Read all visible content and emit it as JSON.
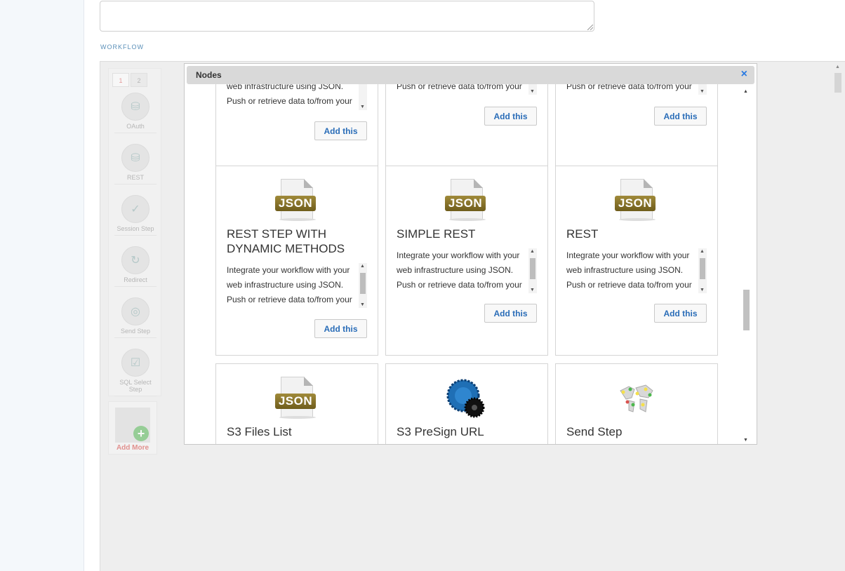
{
  "form": {
    "section_label": "WORKFLOW"
  },
  "steps": {
    "tabs": [
      "1",
      "2"
    ],
    "items": [
      {
        "label": "OAuth",
        "icon": "database-icon"
      },
      {
        "label": "REST",
        "icon": "database-icon"
      },
      {
        "label": "Session Step",
        "icon": "check-circle-icon"
      },
      {
        "label": "Redirect",
        "icon": "redirect-icon"
      },
      {
        "label": "Send Step",
        "icon": "globe-icon"
      },
      {
        "label": "SQL Select Step",
        "icon": "checkbox-icon"
      }
    ],
    "add_more_label": "Add More"
  },
  "dialog": {
    "title": "Nodes",
    "close_icon": "×"
  },
  "cards_top": [
    {
      "desc": "web infrastructure using JSON. Push or retrieve data to/from your",
      "button": "Add this"
    },
    {
      "desc": "Push or retrieve data to/from your",
      "button": "Add this"
    },
    {
      "desc": "Push or retrieve data to/from your",
      "button": "Add this"
    }
  ],
  "cards_mid": [
    {
      "title": "REST STEP WITH DYNAMIC METHODS",
      "icon_label": "JSON",
      "desc": "Integrate your workflow with your web infrastructure using JSON. Push or retrieve data to/from your",
      "button": "Add this"
    },
    {
      "title": "SIMPLE REST",
      "icon_label": "JSON",
      "desc": "Integrate your workflow with your web infrastructure using JSON. Push or retrieve data to/from your",
      "button": "Add this"
    },
    {
      "title": "REST",
      "icon_label": "JSON",
      "desc": "Integrate your workflow with your web infrastructure using JSON. Push or retrieve data to/from your",
      "button": "Add this"
    }
  ],
  "cards_bottom": [
    {
      "title": "S3 Files List",
      "icon_label": "JSON",
      "icon": "json-file-icon"
    },
    {
      "title": "S3 PreSign URL",
      "icon": "blue-gear-icon"
    },
    {
      "title": "Send Step",
      "icon": "world-map-icon"
    }
  ],
  "colors": {
    "accent": "#2a7ae2",
    "label_blue": "#5a8fb8",
    "json_band": "#8a7530"
  }
}
